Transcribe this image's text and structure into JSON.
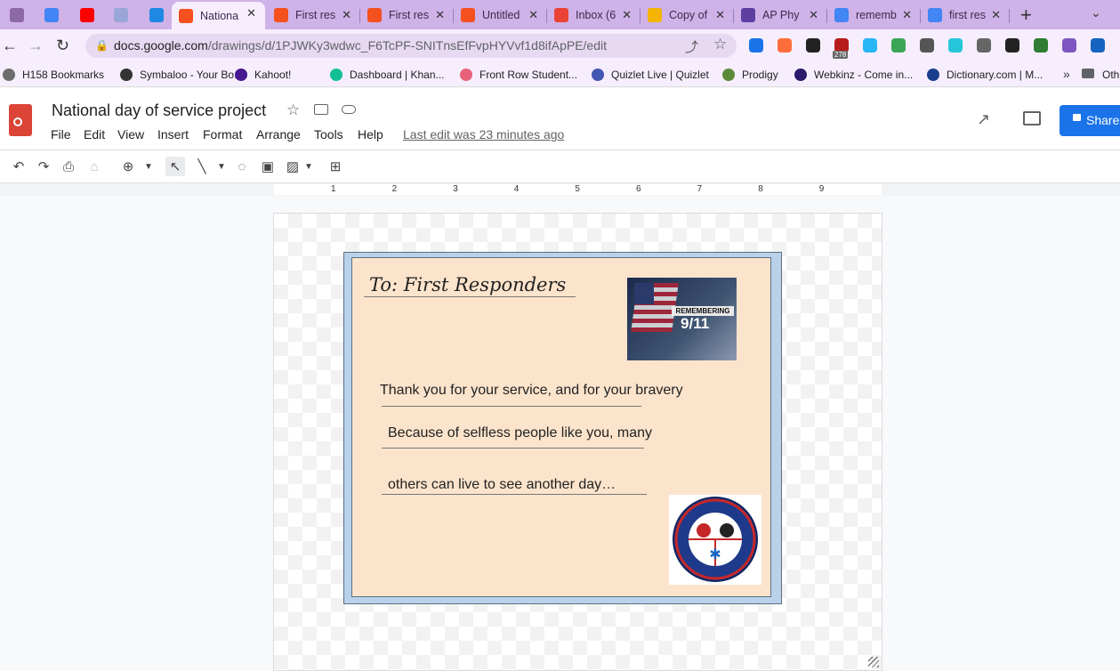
{
  "browser": {
    "tabs": [
      {
        "title": "",
        "color": "#8d6aa6"
      },
      {
        "title": "",
        "color": "#4285f4"
      },
      {
        "title": "",
        "color": "#ff0000"
      },
      {
        "title": "",
        "color": "#9aa6d8"
      },
      {
        "title": "",
        "color": "#1e88e5"
      },
      {
        "title": "Nationa",
        "color": "#f4511e",
        "active": true
      },
      {
        "title": "First res",
        "color": "#f4511e"
      },
      {
        "title": "First res",
        "color": "#f4511e"
      },
      {
        "title": "Untitled",
        "color": "#f4511e"
      },
      {
        "title": "Inbox (6",
        "color": "#ea4335"
      },
      {
        "title": "Copy of",
        "color": "#f4b400"
      },
      {
        "title": "AP Phy",
        "color": "#5c3fa0"
      },
      {
        "title": "rememb",
        "color": "#4285f4"
      },
      {
        "title": "first res",
        "color": "#4285f4"
      }
    ],
    "new_tab": "+",
    "url_host": "docs.google.com",
    "url_path": "/drawings/d/1PJWKy3wdwc_F6TcPF-SNITnsEfFvpHYVvf1d8ifApPE/edit",
    "extension_badge": "278",
    "bookmarks": [
      {
        "label": "H158 Bookmarks",
        "color": "#6d6d6d"
      },
      {
        "label": "Symbaloo - Your Bo...",
        "color": "#333"
      },
      {
        "label": "Kahoot!",
        "color": "#46178f"
      },
      {
        "label": "Dashboard | Khan...",
        "color": "#14bf96"
      },
      {
        "label": "Front Row Student...",
        "color": "#e8637a"
      },
      {
        "label": "Quizlet Live | Quizlet",
        "color": "#4257b2"
      },
      {
        "label": "Prodigy",
        "color": "#5a8a3a"
      },
      {
        "label": "Webkinz - Come in...",
        "color": "#2a1a6b"
      },
      {
        "label": "Dictionary.com | M...",
        "color": "#1a3e8c"
      }
    ],
    "bookmarks_more": "»",
    "other_bookmarks": "Oth"
  },
  "app": {
    "title": "National day of service project",
    "menus": [
      "File",
      "Edit",
      "View",
      "Insert",
      "Format",
      "Arrange",
      "Tools",
      "Help"
    ],
    "last_edit": "Last edit was 23 minutes ago",
    "share_label": "Share"
  },
  "ruler": [
    "1",
    "2",
    "3",
    "4",
    "5",
    "6",
    "7",
    "8",
    "9"
  ],
  "card": {
    "to": "To: First Responders",
    "lines": [
      "Thank you for your service, and for your bravery",
      "Because of selfless people like you, many",
      "others can live to see another day…"
    ],
    "photo_text_top": "REMEMBERING",
    "photo_text_bottom": "9/11",
    "seal_text_top": "FIRST RESPONDERS",
    "seal_text_bottom": "FIRST TO THE FIGHT"
  }
}
